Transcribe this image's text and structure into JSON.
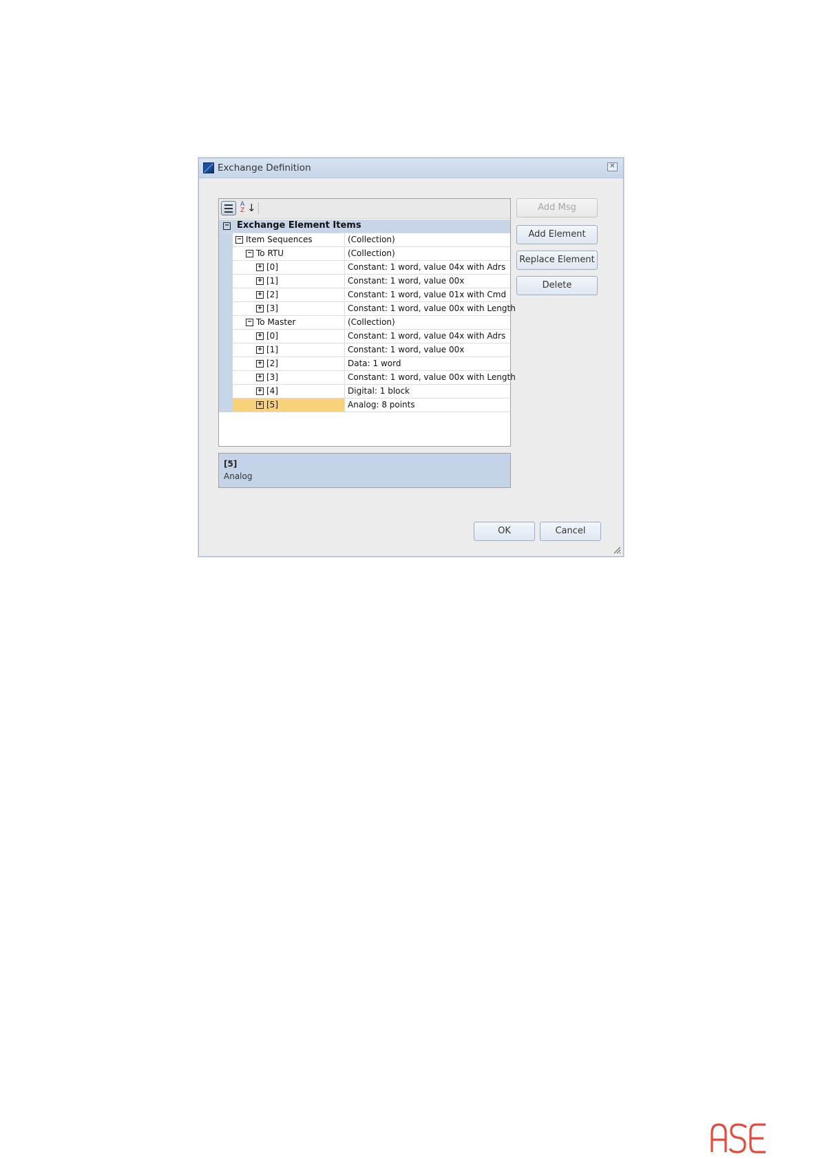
{
  "dialog": {
    "title": "Exchange Definition",
    "close_glyph": "✕"
  },
  "toolbar": {
    "categorized_icon": "categorized-view-icon",
    "alphabetical_icon": "alphabetical-sort-icon",
    "az_top": "A",
    "az_bottom": "Z",
    "az_arrow": "↓"
  },
  "property_grid": {
    "category": "Exchange Element Items",
    "rows": [
      {
        "label": "Item Sequences",
        "value": "(Collection)",
        "toggle": "−",
        "indent": 1,
        "selected": false
      },
      {
        "label": "To RTU",
        "value": "(Collection)",
        "toggle": "−",
        "indent": 2,
        "selected": false
      },
      {
        "label": "[0]",
        "value": "Constant: 1  word, value 04x with Adrs",
        "toggle": "+",
        "indent": 3,
        "selected": false
      },
      {
        "label": "[1]",
        "value": "Constant: 1  word, value 00x",
        "toggle": "+",
        "indent": 3,
        "selected": false
      },
      {
        "label": "[2]",
        "value": "Constant: 1  word, value 01x with Cmd",
        "toggle": "+",
        "indent": 3,
        "selected": false
      },
      {
        "label": "[3]",
        "value": "Constant: 1  word, value 00x with Length",
        "toggle": "+",
        "indent": 3,
        "selected": false
      },
      {
        "label": "To Master",
        "value": "(Collection)",
        "toggle": "−",
        "indent": 2,
        "selected": false
      },
      {
        "label": "[0]",
        "value": "Constant: 1  word, value 04x with Adrs",
        "toggle": "+",
        "indent": 3,
        "selected": false
      },
      {
        "label": "[1]",
        "value": "Constant: 1  word, value 00x",
        "toggle": "+",
        "indent": 3,
        "selected": false
      },
      {
        "label": "[2]",
        "value": "Data: 1  word",
        "toggle": "+",
        "indent": 3,
        "selected": false
      },
      {
        "label": "[3]",
        "value": "Constant: 1  word, value 00x with Length",
        "toggle": "+",
        "indent": 3,
        "selected": false
      },
      {
        "label": "[4]",
        "value": "Digital: 1 block",
        "toggle": "+",
        "indent": 3,
        "selected": false
      },
      {
        "label": "[5]",
        "value": "Analog: 8 points",
        "toggle": "+",
        "indent": 3,
        "selected": true
      }
    ],
    "selected_color": "#f7d27a",
    "category_color": "#c7d5e8"
  },
  "description": {
    "title": "[5]",
    "text": "Analog"
  },
  "buttons": {
    "add_msg": "Add Msg",
    "add_element": "Add Element",
    "replace_element": "Replace Element",
    "delete": "Delete",
    "ok": "OK",
    "cancel": "Cancel"
  },
  "footer": {
    "logo_text": "ASE",
    "logo_color": "#e8473c"
  }
}
